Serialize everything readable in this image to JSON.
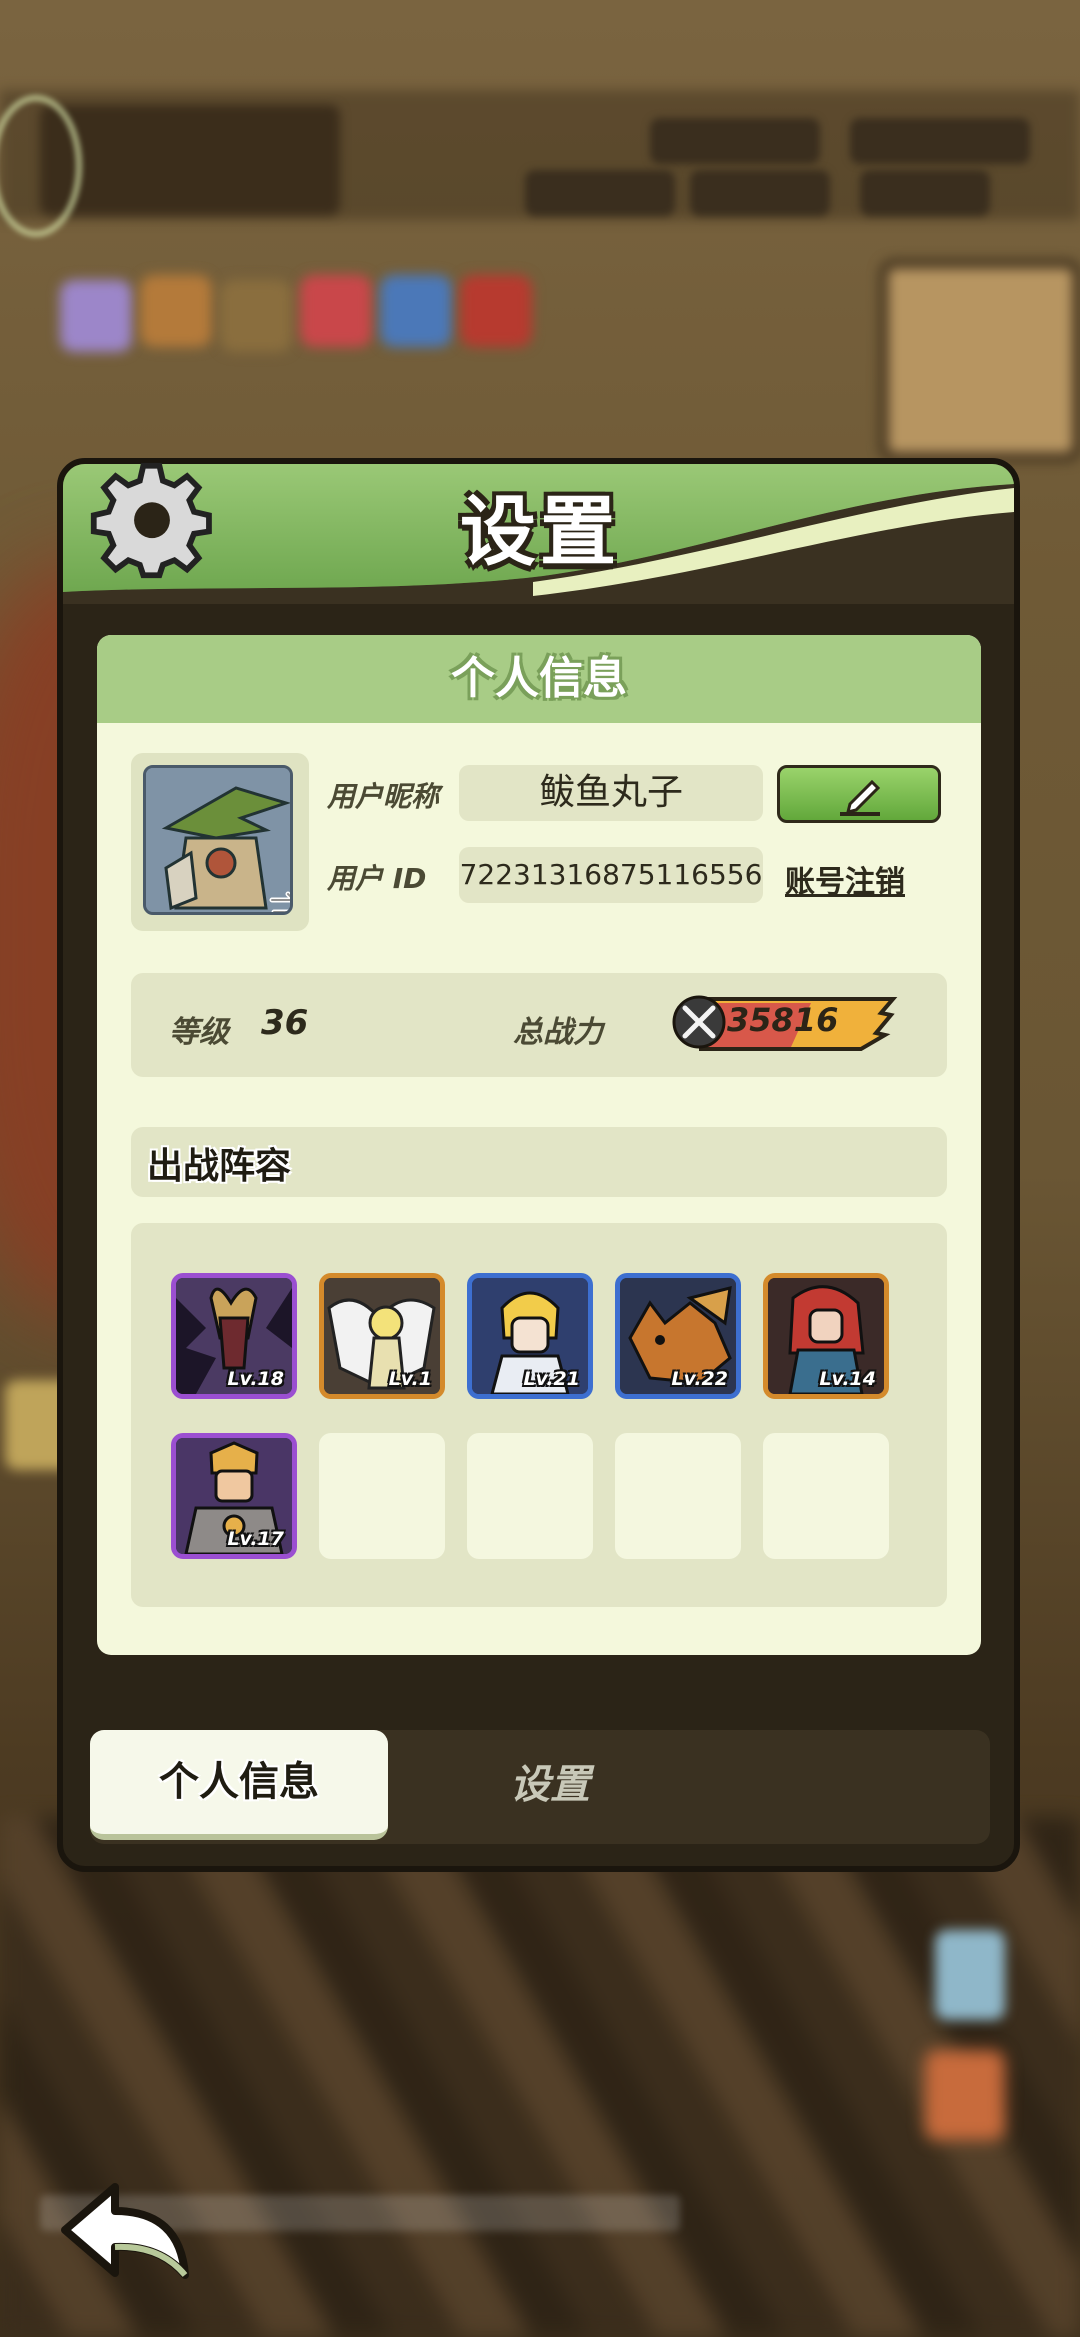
{
  "dialog": {
    "title": "设置"
  },
  "profile_panel": {
    "header": "个人信息",
    "nickname_label": "用户昵称",
    "nickname_value": "鲅鱼丸子",
    "id_label": "用户  ID",
    "id_value": "72231316875116556",
    "deregister_label": "账号注销",
    "level_label": "等级",
    "level_value": "36",
    "power_label": "总战力",
    "power_value": "35816",
    "lineup_title": "出战阵容",
    "lineup": [
      {
        "level": "Lv.18",
        "rarity_color": "#9b4fd1",
        "art": "purple-goat-hero"
      },
      {
        "level": "Lv.1",
        "rarity_color": "#d48a2b",
        "art": "white-angel-hero"
      },
      {
        "level": "Lv.21",
        "rarity_color": "#3d6fd0",
        "art": "blonde-knight-hero"
      },
      {
        "level": "Lv.22",
        "rarity_color": "#3d6fd0",
        "art": "fox-beast-hero"
      },
      {
        "level": "Lv.14",
        "rarity_color": "#d48a2b",
        "art": "red-hair-hero"
      },
      {
        "level": "Lv.17",
        "rarity_color": "#9b4fd1",
        "art": "golden-armor-hero"
      }
    ],
    "empty_slots": 4
  },
  "tabs": {
    "active": "个人信息",
    "other": "设置"
  },
  "icons": {
    "settings": "gear-icon",
    "swap": "swap-arrow-icon",
    "edit": "pencil-icon",
    "power": "crossed-swords-icon",
    "back": "back-arrow-icon"
  },
  "colors": {
    "header_green": "#a8cc86",
    "panel_bg": "#f4f8dc",
    "dialog_frame": "#2b2417",
    "edit_button": "#7dbd52"
  }
}
